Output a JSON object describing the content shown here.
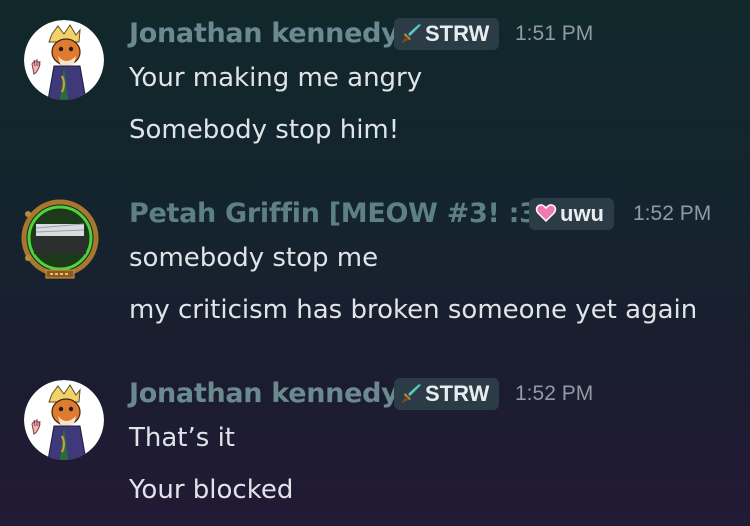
{
  "messages": [
    {
      "author": "Jonathan kennedy",
      "tag": "STRW",
      "tag_icon": "sword-icon",
      "time": "1:51 PM",
      "lines": [
        "Your making me angry",
        "Somebody stop him!"
      ]
    },
    {
      "author": "Petah Griffin [MEOW #3! :3]",
      "tag": "uwu",
      "tag_icon": "heart-icon",
      "time": "1:52 PM",
      "lines": [
        "somebody stop me",
        "my criticism has broken someone yet again"
      ]
    },
    {
      "author": "Jonathan kennedy",
      "tag": "STRW",
      "tag_icon": "sword-icon",
      "time": "1:52 PM",
      "lines": [
        "That’s it",
        "Your blocked"
      ]
    }
  ],
  "colors": {
    "username": "#6a8a90",
    "tag_bg": "#2b3c46",
    "timestamp": "#8f9ba4",
    "message_text": "#e0e4e8",
    "heart": "#f07ab0",
    "sword": "#6fd3d0"
  }
}
